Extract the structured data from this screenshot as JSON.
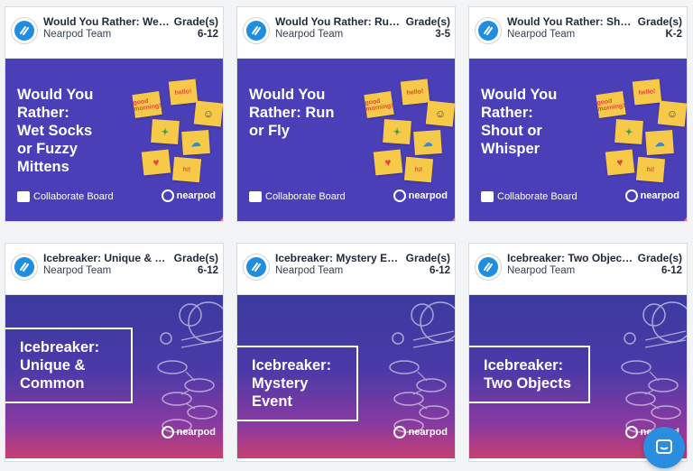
{
  "cards": [
    {
      "title": "Would You Rather: Wet S...",
      "author": "Nearpod Team",
      "grade_label": "Grade(s)",
      "grade": "6-12",
      "thumb_text": "Would You\nRather:\nWet Socks\nor Fuzzy\nMittens",
      "footer": "Collaborate Board",
      "brand": "nearpod"
    },
    {
      "title": "Would You Rather: Run o...",
      "author": "Nearpod Team",
      "grade_label": "Grade(s)",
      "grade": "3-5",
      "thumb_text": "Would You\nRather: Run\nor Fly",
      "footer": "Collaborate Board",
      "brand": "nearpod"
    },
    {
      "title": "Would You Rather: Shout...",
      "author": "Nearpod Team",
      "grade_label": "Grade(s)",
      "grade": "K-2",
      "thumb_text": "Would You\nRather:\nShout or\nWhisper",
      "footer": "Collaborate Board",
      "brand": "nearpod"
    },
    {
      "title": "Icebreaker: Unique & Co...",
      "author": "Nearpod Team",
      "grade_label": "Grade(s)",
      "grade": "6-12",
      "thumb_text": "Icebreaker:\nUnique &\nCommon",
      "brand": "nearpod"
    },
    {
      "title": "Icebreaker: Mystery Even...",
      "author": "Nearpod Team",
      "grade_label": "Grade(s)",
      "grade": "6-12",
      "thumb_text": "Icebreaker:\nMystery Event",
      "brand": "nearpod"
    },
    {
      "title": "Icebreaker: Two Objects: ...",
      "author": "Nearpod Team",
      "grade_label": "Grade(s)",
      "grade": "6-12",
      "thumb_text": "Icebreaker:\nTwo Objects",
      "brand": "nearpod"
    }
  ],
  "sticky_notes": [
    "good morning!",
    "hello!",
    "",
    "",
    "",
    "hi!"
  ],
  "colors": {
    "wyr_bg": "#f1727a",
    "wyr_blob": "#4b3fb7",
    "ice_top": "#3b3a9f",
    "ice_bottom": "#c93f70",
    "chat": "#2a8de0"
  }
}
